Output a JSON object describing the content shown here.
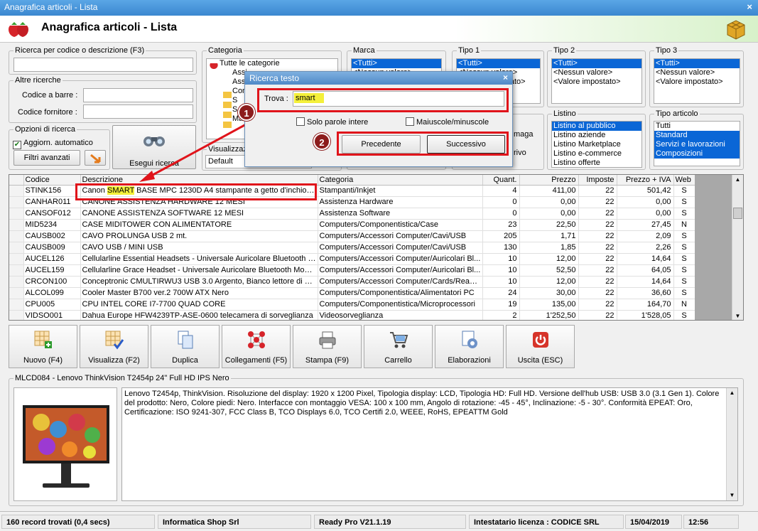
{
  "window": {
    "title": "Anagrafica articoli  - Lista",
    "close": "×"
  },
  "header": {
    "title": "Anagrafica articoli  - Lista"
  },
  "search": {
    "label": "Ricerca per codice o descrizione (F3)",
    "value": ""
  },
  "altre": {
    "label": "Altre ricerche",
    "barcode_label": "Codice a barre :",
    "fornitore_label": "Codice fornitore :"
  },
  "opzioni": {
    "label": "Opzioni di ricerca",
    "auto_label": "Aggiorn. automatico",
    "filtri_label": "Filtri avanzati",
    "esegui_label": "Esegui ricerca"
  },
  "categoria": {
    "label": "Categoria",
    "items": [
      "Tutte le categorie",
      "Assi",
      "Assi",
      "Com",
      "S",
      "S",
      "Ma"
    ]
  },
  "visualizza": {
    "label": "Visualizzazi",
    "value": "Default"
  },
  "marca": {
    "label": "Marca",
    "items": [
      "<Tutti>",
      "<Nessun valore>"
    ]
  },
  "tipo1": {
    "label": "Tipo 1",
    "items": [
      "<Tutti>",
      "<Nessun valore>",
      "<Valore impostato>"
    ]
  },
  "tipo2": {
    "label": "Tipo 2",
    "items": [
      "<Tutti>",
      "<Nessun valore>",
      "<Valore impostato>"
    ]
  },
  "tipo3": {
    "label": "Tipo 3",
    "items": [
      "<Tutti>",
      "<Nessun valore>",
      "<Valore impostato>"
    ]
  },
  "listino": {
    "label": "Listino",
    "items": [
      "Listino al pubblico",
      "Listino aziende",
      "Listino Marketplace",
      "Listino e-commerce",
      "Listino offerte"
    ]
  },
  "tipoart": {
    "label": "Tipo articolo",
    "items": [
      "Tutti",
      "Standard",
      "Servizi e lavorazioni",
      "Composizioni"
    ]
  },
  "dialog": {
    "title": "Ricerca testo",
    "close": "×",
    "trova_label": "Trova :",
    "trova_value": "smart",
    "parole_label": "Solo parole intere",
    "maiuscole_label": "Maiuscole/minuscole",
    "precedente_label": "Precedente",
    "successivo_label": "Successivo",
    "partial_labels": [
      "maga",
      "rivo"
    ]
  },
  "badges": {
    "one": "1",
    "two": "2"
  },
  "grid": {
    "headers": [
      "Codice",
      "Descrizione",
      "Categoria",
      "Quant.",
      "Prezzo",
      "Imposte",
      "Prezzo + IVA",
      "Web"
    ],
    "first_desc": {
      "pre": "Canon ",
      "hit": "SMART",
      "post": " BASE MPC 1230D A4 stampante a getto d'inchiostro"
    },
    "rows": [
      [
        "STINK156",
        "",
        "Stampanti/Inkjet",
        "4",
        "411,00",
        "22",
        "501,42",
        "S"
      ],
      [
        "CANHAR011",
        "CANONE ASSISTENZA HARDWARE 12 MESI",
        "Assistenza Hardware",
        "0",
        "0,00",
        "22",
        "0,00",
        "S"
      ],
      [
        "CANSOF012",
        "CANONE ASSISTENZA SOFTWARE 12 MESI",
        "Assistenza Software",
        "0",
        "0,00",
        "22",
        "0,00",
        "S"
      ],
      [
        "MID5234",
        "CASE MIDITOWER CON ALIMENTATORE",
        "Computers/Componentistica/Case",
        "23",
        "22,50",
        "22",
        "27,45",
        "N"
      ],
      [
        "CAUSB002",
        "CAVO PROLUNGA USB 2 mt.",
        "Computers/Accessori Computer/Cavi/USB",
        "205",
        "1,71",
        "22",
        "2,09",
        "S"
      ],
      [
        "CAUSB009",
        "CAVO USB / MINI USB",
        "Computers/Accessori Computer/Cavi/USB",
        "130",
        "1,85",
        "22",
        "2,26",
        "S"
      ],
      [
        "AUCEL126",
        "Cellularline Essential Headsets - Universale Auricolare Bluetooth m...",
        "Computers/Accessori Computer/Auricolari Bl...",
        "10",
        "12,00",
        "22",
        "14,64",
        "S"
      ],
      [
        "AUCEL159",
        "Cellularline Grace Headset - Universale Auricolare Bluetooth Mono...",
        "Computers/Accessori Computer/Auricolari Bl...",
        "10",
        "52,50",
        "22",
        "64,05",
        "S"
      ],
      [
        "CRCON100",
        "Conceptronic CMULTIRWU3 USB 3.0 Argento, Bianco lettore di sc...",
        "Computers/Accessori Computer/Cards/Readers",
        "10",
        "12,00",
        "22",
        "14,64",
        "S"
      ],
      [
        "ALCOL099",
        "Cooler Master B700 ver.2 700W ATX Nero",
        "Computers/Componentistica/Alimentatori PC",
        "24",
        "30,00",
        "22",
        "36,60",
        "S"
      ],
      [
        "CPU005",
        "CPU INTEL CORE I7-7700 QUAD CORE",
        "Computers/Componentistica/Microprocessori",
        "19",
        "135,00",
        "22",
        "164,70",
        "N"
      ],
      [
        "VIDSO001",
        "Dahua Europe HFW4239TP-ASE-0600 telecamera di sorveglianza",
        "Videosorveglianza",
        "2",
        "1'252,50",
        "22",
        "1'528,05",
        "S"
      ]
    ]
  },
  "toolbar": {
    "nuovo": "Nuovo (F4)",
    "visualizza": "Visualizza (F2)",
    "duplica": "Duplica",
    "collegamenti": "Collegamenti (F5)",
    "stampa": "Stampa (F9)",
    "carrello": "Carrello",
    "elaborazioni": "Elaborazioni",
    "uscita": "Uscita (ESC)"
  },
  "detail": {
    "label": "MLCD084 - Lenovo ThinkVision T2454p 24\" Full HD IPS Nero",
    "text": "Lenovo T2454p, ThinkVision. Risoluzione del display: 1920 x 1200 Pixel, Tipologia display: LCD, Tipologia HD: Full HD. Versione dell'hub USB: USB 3.0 (3.1 Gen 1). Colore del prodotto: Nero, Colore piedi: Nero. Interfacce con montaggio VESA: 100 x 100 mm, Angolo di rotazione: -45 - 45°, Inclinazione: -5 - 30°. Conformità EPEAT: Oro, Certificazione: ISO 9241-307, FCC Class B, TCO Displays 6.0, TCO Certifi 2.0, WEEE, RoHS, EPEATTM Gold"
  },
  "status": {
    "records": "160 record trovati (0,4 secs)",
    "company": "Informatica Shop Srl",
    "version": "Ready Pro V21.1.19",
    "license": "Intestatario licenza : CODICE SRL",
    "date": "15/04/2019",
    "time": "12:56"
  },
  "colors": {
    "accent": "#0a66d6",
    "highlight": "#e0141b",
    "badge": "#8c1c1c"
  }
}
